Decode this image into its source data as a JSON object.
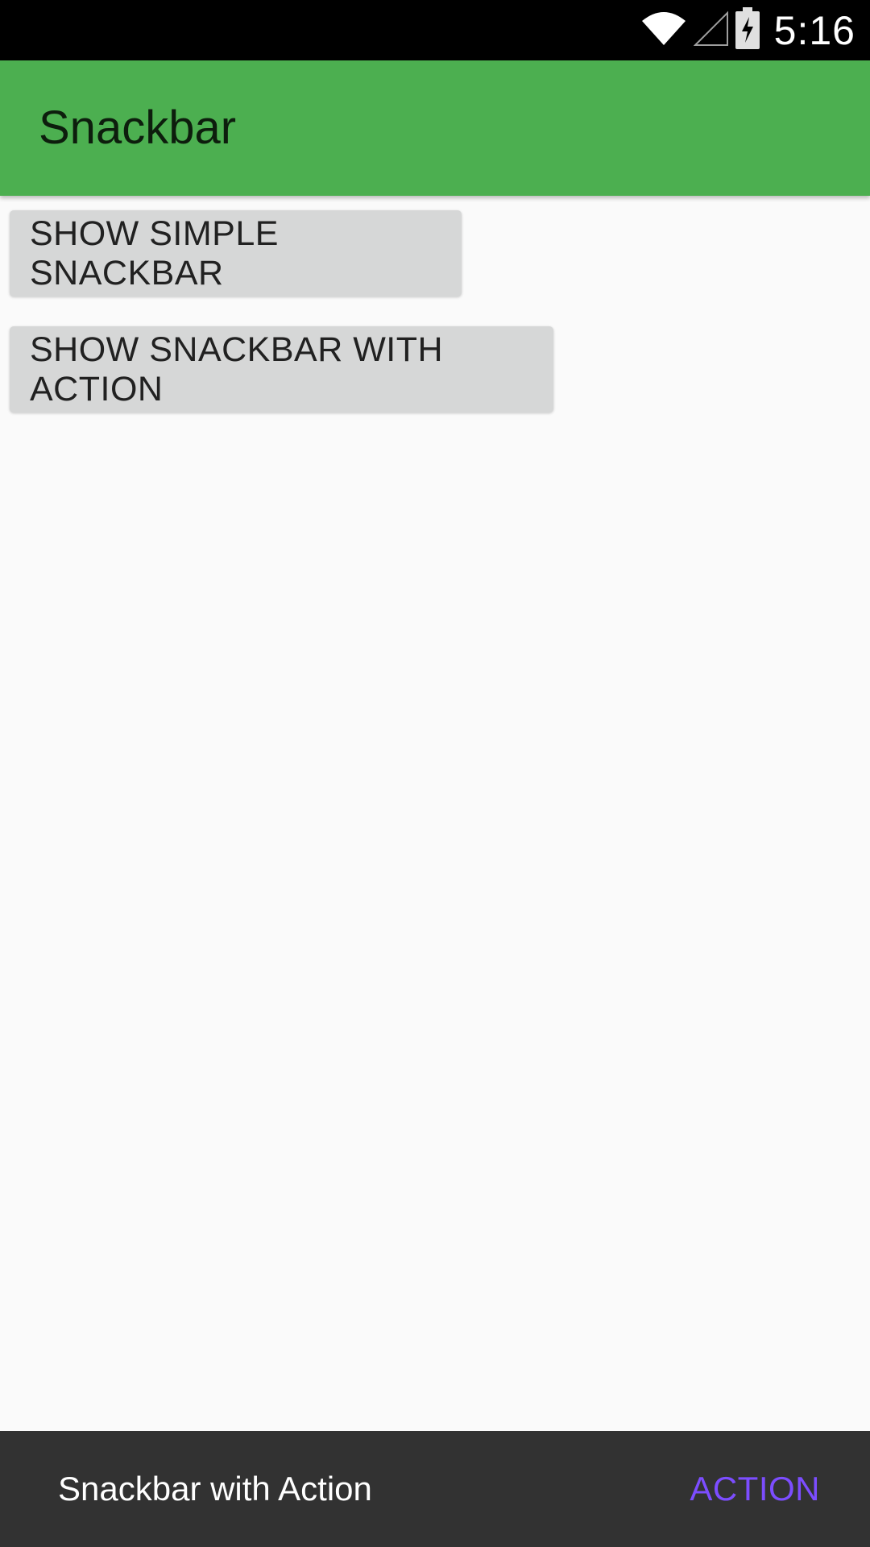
{
  "status_bar": {
    "time": "5:16",
    "icons": [
      "wifi-icon",
      "cell-signal-icon",
      "battery-charging-icon"
    ]
  },
  "app_bar": {
    "title": "Snackbar",
    "color": "#4caf50"
  },
  "buttons": {
    "simple_label": "SHOW SIMPLE SNACKBAR",
    "action_label": "SHOW SNACKBAR WITH ACTION"
  },
  "snackbar": {
    "message": "Snackbar with Action",
    "action_label": "ACTION",
    "action_color": "#7c4dff",
    "background": "#323232"
  }
}
